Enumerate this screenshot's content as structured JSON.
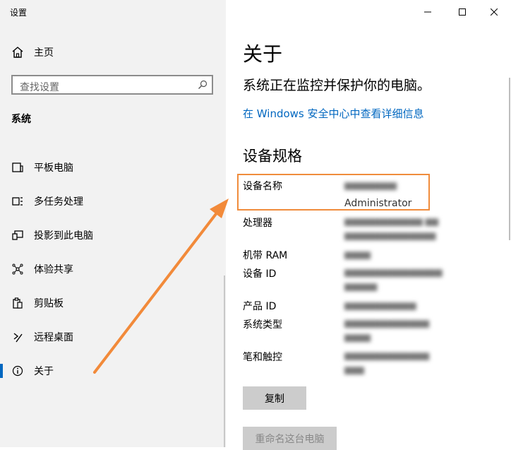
{
  "window": {
    "title": "设置",
    "accent": "#0067c0"
  },
  "sidebar": {
    "home_label": "主页",
    "search_placeholder": "查找设置",
    "section_title": "系统",
    "items": [
      {
        "label": "平板电脑",
        "icon": "tablet-icon"
      },
      {
        "label": "多任务处理",
        "icon": "multitasking-icon"
      },
      {
        "label": "投影到此电脑",
        "icon": "projecting-icon"
      },
      {
        "label": "体验共享",
        "icon": "shared-experiences-icon"
      },
      {
        "label": "剪贴板",
        "icon": "clipboard-icon"
      },
      {
        "label": "远程桌面",
        "icon": "remote-desktop-icon"
      },
      {
        "label": "关于",
        "icon": "info-icon",
        "active": true
      }
    ]
  },
  "main": {
    "title": "关于",
    "status": "系统正在监控并保护你的电脑。",
    "security_link": "在 Windows 安全中心中查看详细信息",
    "specs_title": "设备规格",
    "specs": {
      "device_name_label": "设备名称",
      "device_name_value": "Administrator",
      "processor_label": "处理器",
      "ram_label": "机带 RAM",
      "device_id_label": "设备 ID",
      "product_id_label": "产品 ID",
      "system_type_label": "系统类型",
      "pen_touch_label": "笔和触控"
    },
    "copy_button": "复制",
    "rename_button": "重命名这台电脑"
  },
  "annotation": {
    "highlight_color": "#f08c3c",
    "arrow_color": "#f28a3a"
  }
}
